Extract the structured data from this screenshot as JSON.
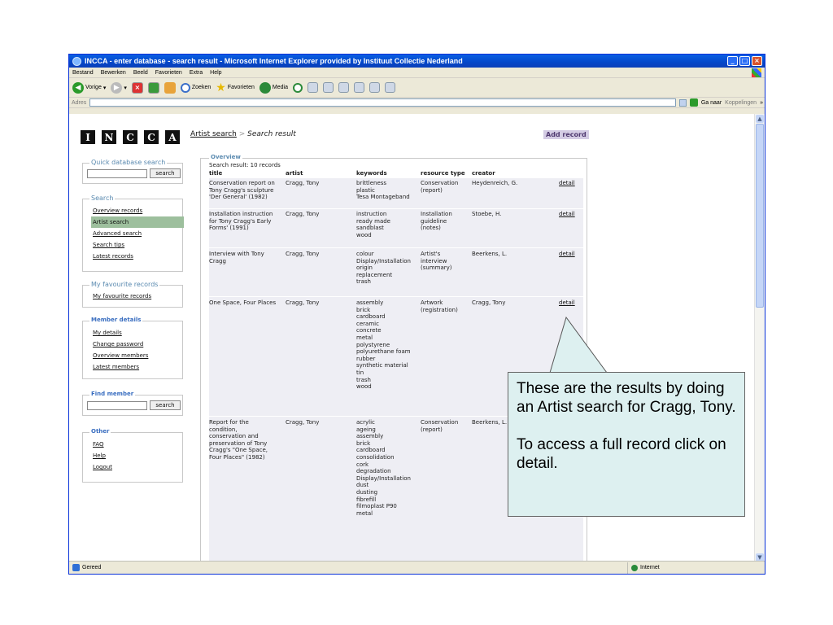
{
  "window": {
    "title": "INCCA - enter database - search result - Microsoft Internet Explorer provided by Instituut Collectie Nederland"
  },
  "menu": [
    "Bestand",
    "Bewerken",
    "Beeld",
    "Favorieten",
    "Extra",
    "Help"
  ],
  "toolbar": {
    "back": "Vorige",
    "search": "Zoeken",
    "favorites": "Favorieten",
    "media": "Media"
  },
  "address": {
    "label": "Adres",
    "go": "Ga naar",
    "links": "Koppelingen"
  },
  "status": {
    "text": "Gereed",
    "zone": "Internet"
  },
  "page": {
    "logo": [
      "I",
      "N",
      "C",
      "C",
      "A"
    ],
    "crumb_link": "Artist search",
    "crumb_sep": ">",
    "crumb_current": "Search result",
    "add_record": "Add record",
    "quick_search": {
      "legend": "Quick database search",
      "button": "search"
    },
    "search_box": {
      "legend": "Search",
      "links": [
        "Overview records",
        "Artist search",
        "Advanced search",
        "Search tips",
        "Latest records"
      ]
    },
    "favourites": {
      "legend": "My favourite records",
      "links": [
        "My favourite records"
      ]
    },
    "member": {
      "legend": "Member details",
      "links": [
        "My details",
        "Change password",
        "Overview members",
        "Latest members"
      ]
    },
    "find_member": {
      "legend": "Find member",
      "button": "search"
    },
    "other": {
      "legend": "Other",
      "links": [
        "FAQ",
        "Help",
        "Logout"
      ]
    }
  },
  "results": {
    "legend": "Overview",
    "count": "Search result: 10 records",
    "headers": [
      "title",
      "artist",
      "keywords",
      "resource type",
      "creator"
    ],
    "detail_label": "detail",
    "rows": [
      {
        "title": "Conservation report on\nTony Cragg's sculpture\n'Der General' (1982)",
        "artist": "Cragg, Tony",
        "keywords": "brittleness\nplastic\nTesa Montageband",
        "type": "Conservation\n(report)",
        "creator": "Heydenreich, G."
      },
      {
        "title": "Installation instruction\nfor Tony Cragg's Early\nForms' (1991)",
        "artist": "Cragg, Tony",
        "keywords": "instruction\nready made\nsandblast\nwood",
        "type": "Installation\nguideline\n(notes)",
        "creator": "Stoebe, H."
      },
      {
        "title": "Interview with Tony\nCragg",
        "artist": "Cragg, Tony",
        "keywords": "colour\nDisplay/Installation\norigin\nreplacement\ntrash",
        "type": "Artist's\ninterview\n(summary)",
        "creator": "Beerkens, L."
      },
      {
        "title": "One Space, Four Places",
        "artist": "Cragg, Tony",
        "keywords": "assembly\nbrick\ncardboard\nceramic\nconcrete\nmetal\npolystyrene\npolyurethane foam\nrubber\nsynthetic material\ntin\ntrash\nwood",
        "type": "Artwork\n(registration)",
        "creator": "Cragg, Tony"
      },
      {
        "title": "Report for the\ncondition,\nconservation and\npreservation of Tony\nCragg's \"One Space,\nFour Places\" (1982)",
        "artist": "Cragg, Tony",
        "keywords": "acrylic\nageing\nassembly\nbrick\ncardboard\nconsolidation\ncork\ndegradation\nDisplay/Installation\ndust\ndusting\nfibrefill\nfilmoplast P90\nmetal",
        "type": "Conservation\n(report)",
        "creator": "Beerkens, L."
      }
    ]
  },
  "callout": {
    "line1": "These are the results by doing an Artist search for Cragg, Tony.",
    "line2": "To access a full record click on detail."
  }
}
